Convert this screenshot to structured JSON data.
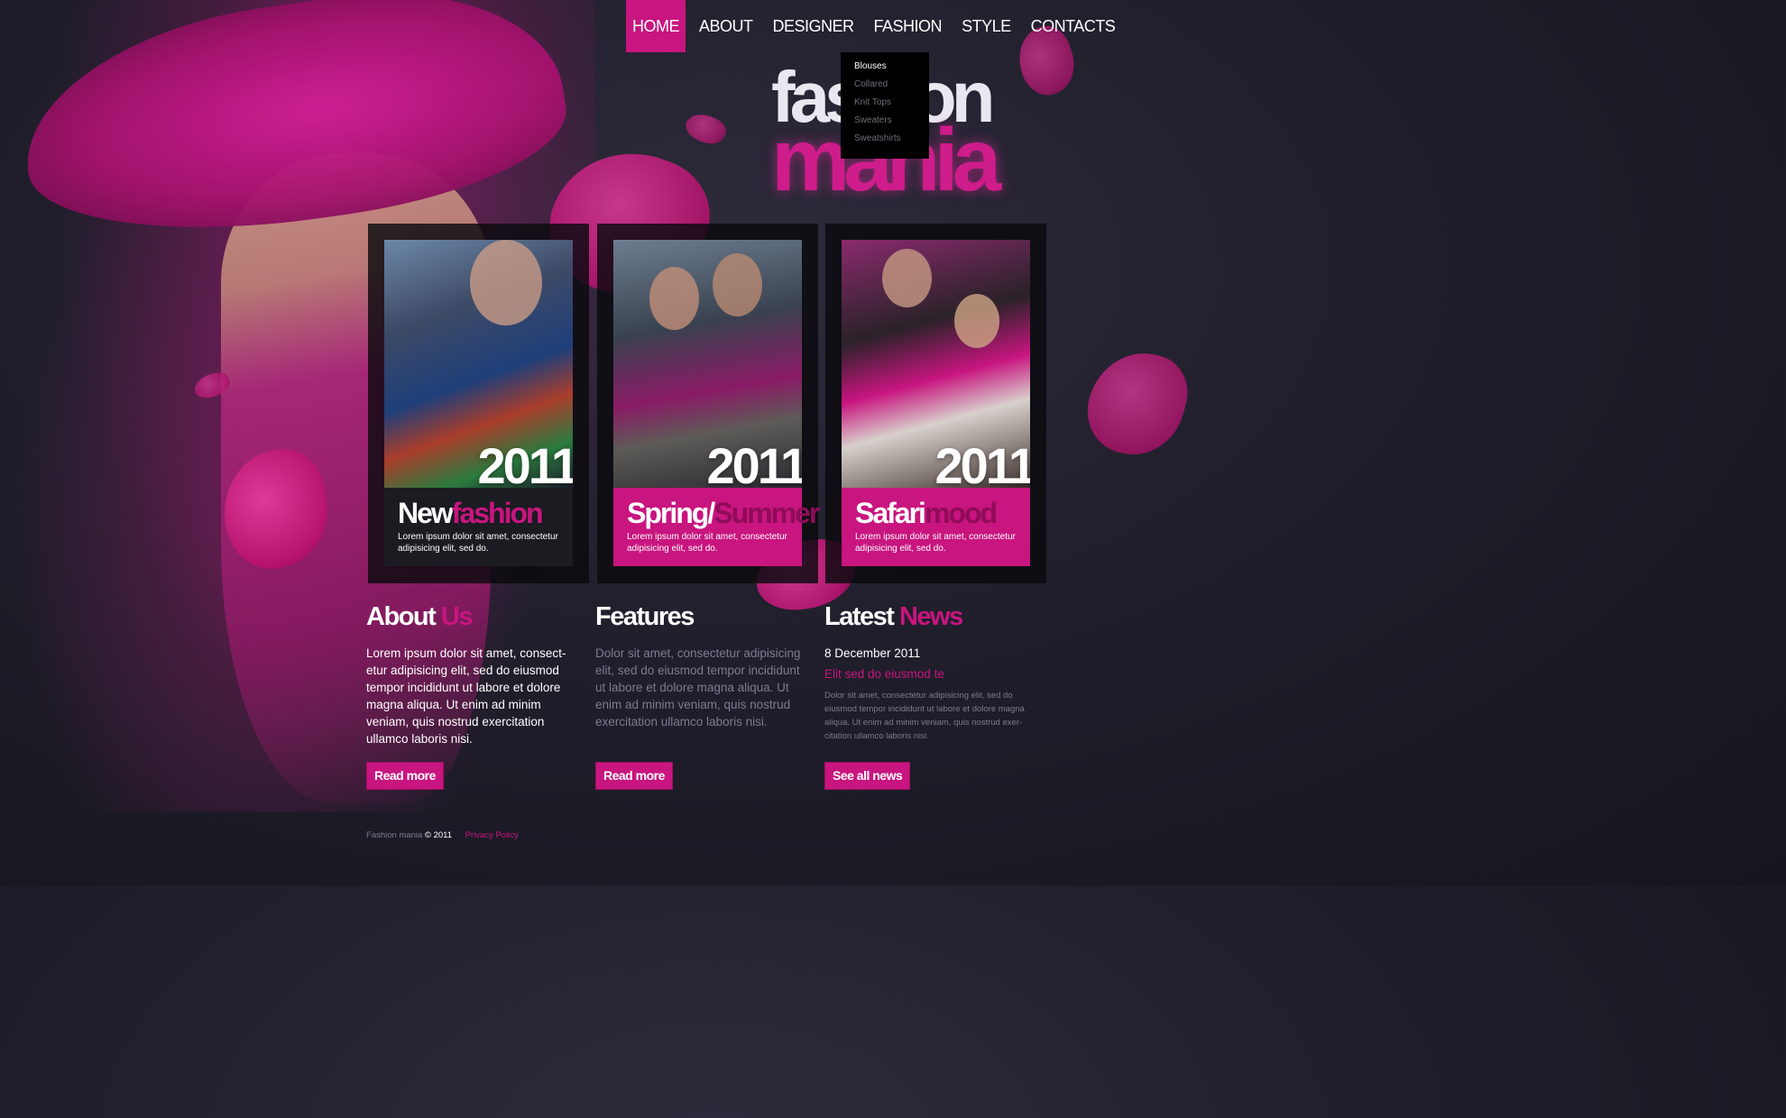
{
  "nav": {
    "items": [
      "HOME",
      "ABOUT",
      "DESIGNER",
      "FASHION",
      "STYLE",
      "CONTACTS"
    ],
    "active_index": 0
  },
  "dropdown": {
    "items": [
      "Blouses",
      "Collared",
      "Knit Tops",
      "Sweaters",
      "Sweatshirts"
    ]
  },
  "logo": {
    "line1": "fashion",
    "line2": "mania"
  },
  "cards": [
    {
      "year": "2011",
      "title_a": "New",
      "title_b": "fashion",
      "text": "Lorem ipsum dolor sit amet, consectetur adipisicing elit, sed do."
    },
    {
      "year": "2011",
      "title_a": "Spring/",
      "title_b": "Summer",
      "text": "Lorem ipsum dolor sit amet, consectetur adipisicing elit, sed do."
    },
    {
      "year": "2011",
      "title_a": "Safari",
      "title_b": "mood",
      "text": "Lorem ipsum dolor sit amet, consectetur adipisicing elit, sed do."
    }
  ],
  "about": {
    "title_a": "About",
    "title_b": "Us",
    "text": "Lorem ipsum dolor sit amet, consect-etur adipisicing elit, sed do eiusmod tempor incididunt ut labore et dolore magna aliqua. Ut enim ad minim veniam, quis nostrud exercitation ullamco laboris nisi.",
    "button": "Read more"
  },
  "features": {
    "title": "Features",
    "text": "Dolor sit amet, consectetur adipisicing elit, sed do eiusmod tempor incididunt ut labore et dolore magna aliqua. Ut enim ad minim veniam, quis nostrud exercitation ullamco laboris nisi.",
    "button": "Read more"
  },
  "news": {
    "title_a": "Latest",
    "title_b": "News",
    "date": "8 December 2011",
    "headline": "Elit sed do eiusmod te",
    "text": "Dolor sit amet, consectetur adipisicing elit, sed do eiusmod tempor incididunt ut labore et dolore magna aliqua. Ut enim ad minim veniam, quis nostrud exer-citation ullamco laboris nisi.",
    "button": "See all news"
  },
  "footer": {
    "brand": "Fashion mania",
    "copyright": "© 2011",
    "privacy": "Privacy Policy"
  },
  "colors": {
    "accent": "#c8157f",
    "background": "#1e1c28",
    "muted_text": "#7c7b93"
  }
}
